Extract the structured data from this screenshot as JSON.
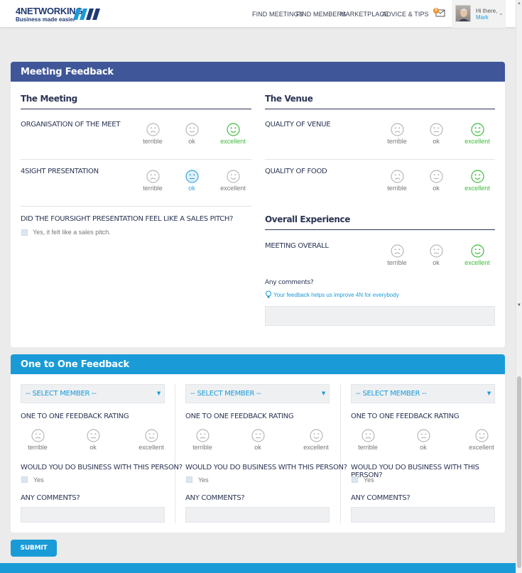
{
  "header": {
    "logo_top": "4NETWORKING",
    "logo_bottom": "Business made easier",
    "nav": [
      "FIND MEETINGS",
      "FIND MEMBERS",
      "MARKETPLACE",
      "ADVICE & TIPS"
    ],
    "notification_count": "0",
    "greeting": "Hi there,",
    "user_name": "Mark"
  },
  "meeting_feedback": {
    "title": "Meeting Feedback",
    "meeting_section": "The Meeting",
    "venue_section": "The Venue",
    "overall_section": "Overall Experience",
    "rating_labels": [
      "terrible",
      "ok",
      "excellent"
    ],
    "questions": [
      {
        "label": "ORGANISATION OF THE MEET",
        "selected": "excellent"
      },
      {
        "label": "4SIGHT PRESENTATION",
        "selected": "ok"
      },
      {
        "label": "QUALITY OF VENUE",
        "selected": "excellent"
      },
      {
        "label": "QUALITY OF FOOD",
        "selected": "excellent"
      },
      {
        "label": "MEETING OVERALL",
        "selected": "excellent"
      }
    ],
    "sales_pitch_question": "DID THE FOURSIGHT PRESENTATION FEEL LIKE A SALES PITCH?",
    "sales_pitch_option": "Yes, it felt like a sales pitch.",
    "comments_label": "Any comments?",
    "comments_hint": "Your feedback helps us improve 4N for everybody"
  },
  "one_to_one": {
    "title": "One to One Feedback",
    "select_placeholder": "-- SELECT MEMBER --",
    "rating_label": "ONE TO ONE FEEDBACK RATING",
    "business_question": "WOULD YOU DO BUSINESS WITH THIS PERSON?",
    "yes_label": "Yes",
    "comments_label": "ANY COMMENTS?"
  },
  "submit_label": "SUBMIT",
  "colors": {
    "meeting_header": "#3f5699",
    "one_to_one_header": "#1a9bd7",
    "excellent": "#3cbb3c",
    "ok_selected": "#3aa6d8",
    "unselected": "#b7b7b7"
  }
}
